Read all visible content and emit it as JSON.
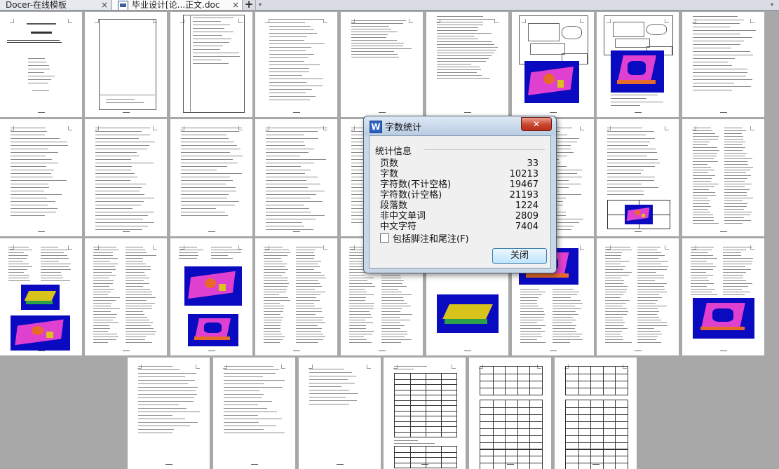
{
  "tabs": [
    {
      "label": "Docer-在线模板",
      "close": "×"
    },
    {
      "label": "毕业设计[论...正文.doc",
      "close": "×"
    }
  ],
  "new_tab_symbol": "+",
  "dropdown_symbol": "▾",
  "dialog": {
    "title": "字数统计",
    "app_icon": "W",
    "close_symbol": "✕",
    "group_label": "统计信息",
    "stats": [
      {
        "label": "页数",
        "value": "33"
      },
      {
        "label": "字数",
        "value": "10213"
      },
      {
        "label": "字符数(不计空格)",
        "value": "19467"
      },
      {
        "label": "字符数(计空格)",
        "value": "21193"
      },
      {
        "label": "段落数",
        "value": "1224"
      },
      {
        "label": "非中文单词",
        "value": "2809"
      },
      {
        "label": "中文字符",
        "value": "7404"
      }
    ],
    "checkbox_label": "包括脚注和尾注(F)",
    "checkbox_checked": false,
    "close_button": "关闭"
  },
  "colors": {
    "workspace": "#a8a8a8",
    "model_background": "#0a0ac0",
    "model_magenta": "#e040d0",
    "model_orange": "#e86a2a",
    "model_yellow": "#d8c21c"
  }
}
